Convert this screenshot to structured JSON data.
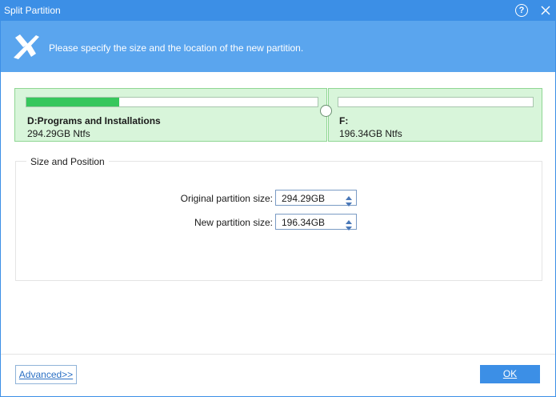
{
  "window": {
    "title": "Split Partition",
    "help_label": "?"
  },
  "banner": {
    "instruction": "Please specify the size and the location of the new partition."
  },
  "partitions": [
    {
      "name": "D:Programs and Installations",
      "size": "294.29GB Ntfs",
      "used_fraction": 0.32
    },
    {
      "name": "F:",
      "size": "196.34GB Ntfs",
      "used_fraction": 0.0
    }
  ],
  "size_position": {
    "group_title": "Size and Position",
    "original_label": "Original partition size:",
    "original_value": "294.29GB",
    "new_label": "New partition size:",
    "new_value": "196.34GB"
  },
  "footer": {
    "advanced_label": "Advanced>>",
    "ok_label": "OK"
  },
  "colors": {
    "titlebar": "#3c8fe6",
    "banner": "#5aa5ee",
    "partition_bg": "#d8f5da",
    "usage_fill": "#36c75c"
  },
  "icons": {
    "logo": "partition-split-logo-icon",
    "help": "help-icon",
    "close": "close-icon",
    "spin_up": "spin-up-icon",
    "spin_down": "spin-down-icon"
  }
}
